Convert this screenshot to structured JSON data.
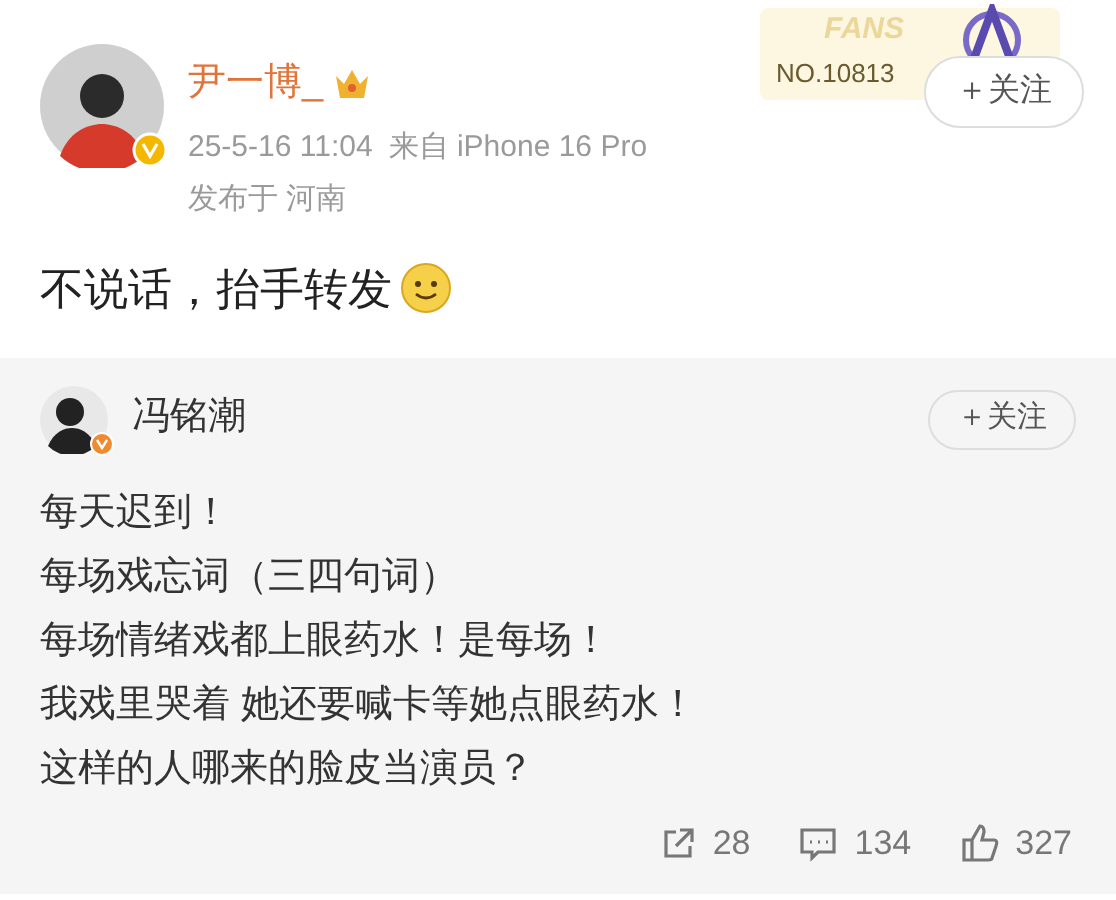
{
  "post": {
    "author": "尹一博_",
    "time": "25-5-16 11:04",
    "source": "来自 iPhone 16 Pro",
    "location": "发布于 河南",
    "text": "不说话，抬手转发",
    "fans_badge": {
      "label": "FANS",
      "number": "NO.10813"
    },
    "follow_button": "＋关注"
  },
  "repost": {
    "author": "冯铭潮",
    "follow_button": "＋关注",
    "lines": [
      "每天迟到！",
      "每场戏忘词（三四句词）",
      "每场情绪戏都上眼药水！是每场！",
      "我戏里哭着 她还要喊卡等她点眼药水！",
      "这样的人哪来的脸皮当演员？"
    ],
    "actions": [
      {
        "kind": "repost",
        "count": "28"
      },
      {
        "kind": "comment",
        "count": "134"
      },
      {
        "kind": "like",
        "count": "327"
      }
    ]
  }
}
